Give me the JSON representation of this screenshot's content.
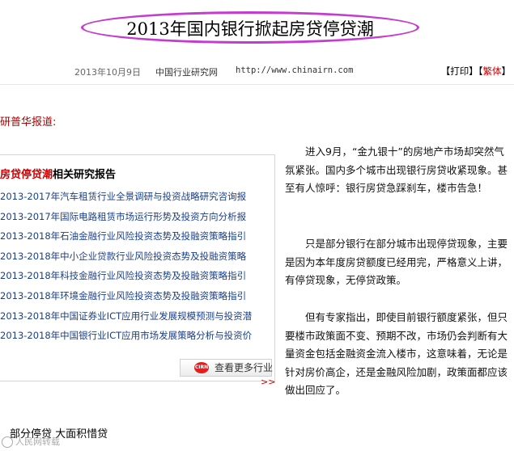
{
  "header": {
    "title": "2013年国内银行掀起房贷停贷潮",
    "date": "2013年10月9日",
    "source": "中国行业研究网",
    "url": "http://www.chinairn.com",
    "print_label": "打印",
    "traditional_label": "繁体",
    "bracket_open": "【",
    "bracket_close": "】"
  },
  "intro": "研普华报道:",
  "related": {
    "title_highlight": "房贷停贷潮",
    "title_rest": "相关研究报告",
    "items": [
      "2013-2017年汽车租赁行业全景调研与投资战略研究咨询报",
      "2013-2017年国际电路租赁市场运行形势及投资方向分析报",
      "2013-2018年石油金融行业风险投资态势及投融资策略指引",
      "2013-2018年中小企业贷款行业风险投资态势及投融资策略",
      "2013-2018年科技金融行业风险投资态势及投融资策略指引",
      "2013-2018年环境金融行业风险投资态势及投融资策略指引",
      "2013-2018年中国证券业ICT应用行业发展规模预测与投资潜",
      "2013-2018年中国银行业ICT应用市场发展策略分析与投资价"
    ],
    "more_label": "查看更多行业",
    "logo_text": "CIRN",
    "more_arrow": ">>"
  },
  "article": {
    "paragraphs": [
      "进入9月，“金九银十”的房地产市场却突然气氛紧张。国内多个城市出现银行房贷收紧现象。甚至有人惊呼：银行房贷急踩刹车，楼市告急！",
      "只是部分银行在部分城市出现停贷现象，主要是因为本年度房贷额度已经用完，严格意义上讲，有停贷现象，无停贷政策。",
      "但有专家指出，即使目前银行额度紧张，但只要楼市政策面不变、预期不改，市场仍会判断有大量资金包括金融资金流入楼市，这意味着，无论是针对房价高企，还是金融风险加剧，政策面都应该做出回应了。"
    ],
    "subhead": "部分停贷 大面积惜贷"
  },
  "watermark": "人民网转载",
  "colors": {
    "ellipse": "#c43bd0",
    "accent_red": "#cc0000",
    "link_blue": "#1a3f8a"
  }
}
